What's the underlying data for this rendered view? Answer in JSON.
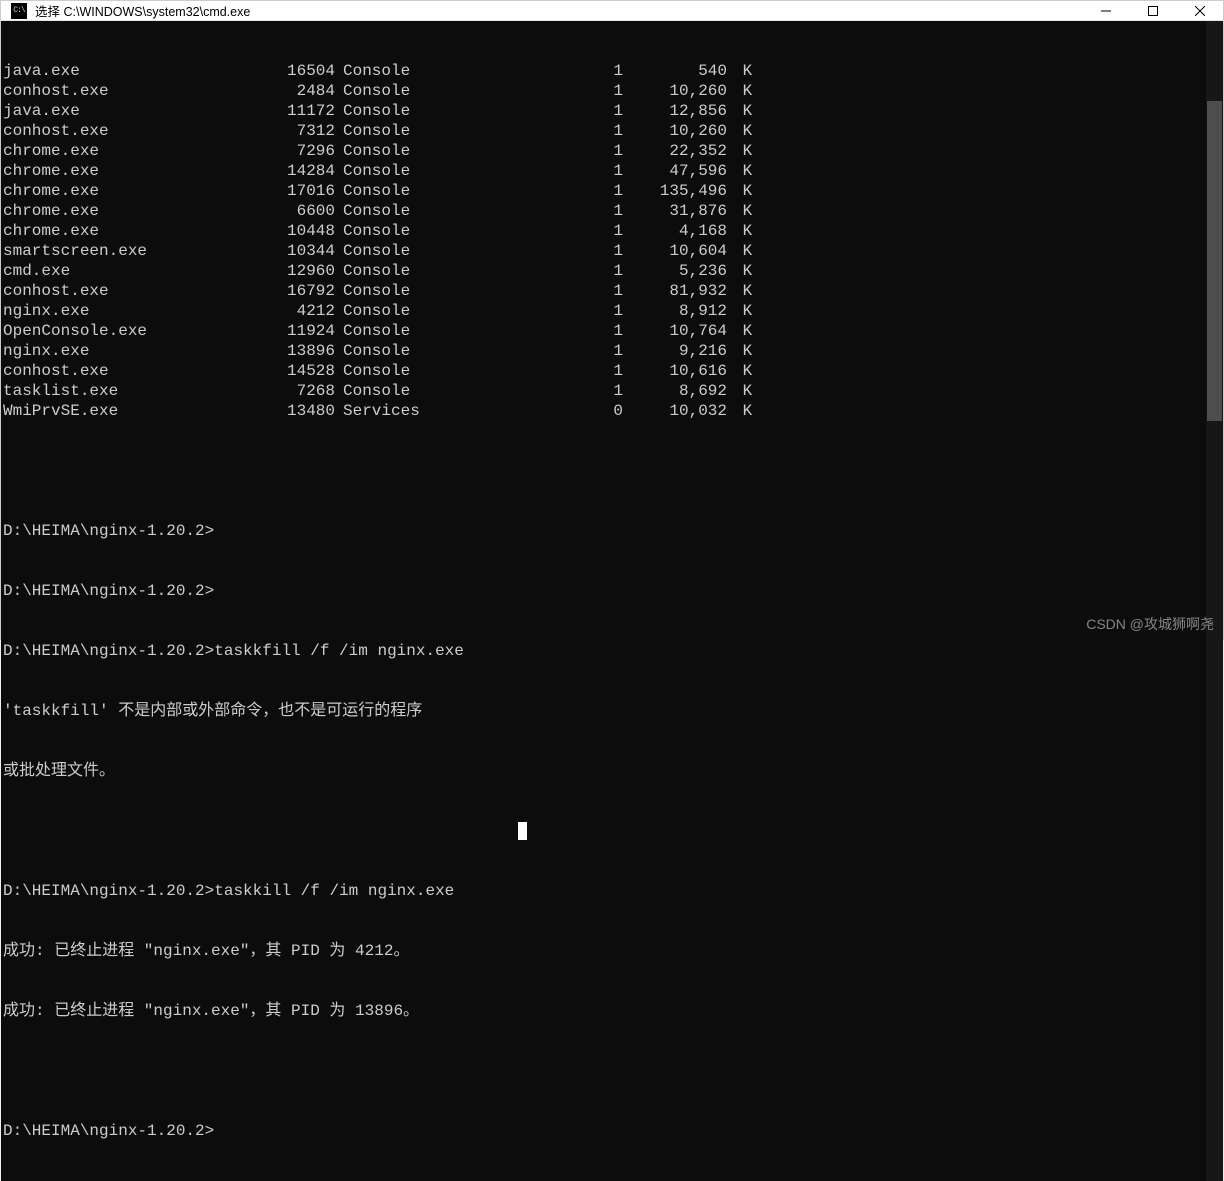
{
  "window": {
    "title": "选择 C:\\WINDOWS\\system32\\cmd.exe",
    "icon_label": "C:\\"
  },
  "processes": [
    {
      "name": "java.exe",
      "pid": "16504",
      "session": "Console",
      "snum": "1",
      "mem": "540",
      "unit": "K"
    },
    {
      "name": "conhost.exe",
      "pid": "2484",
      "session": "Console",
      "snum": "1",
      "mem": "10,260",
      "unit": "K"
    },
    {
      "name": "java.exe",
      "pid": "11172",
      "session": "Console",
      "snum": "1",
      "mem": "12,856",
      "unit": "K"
    },
    {
      "name": "conhost.exe",
      "pid": "7312",
      "session": "Console",
      "snum": "1",
      "mem": "10,260",
      "unit": "K"
    },
    {
      "name": "chrome.exe",
      "pid": "7296",
      "session": "Console",
      "snum": "1",
      "mem": "22,352",
      "unit": "K"
    },
    {
      "name": "chrome.exe",
      "pid": "14284",
      "session": "Console",
      "snum": "1",
      "mem": "47,596",
      "unit": "K"
    },
    {
      "name": "chrome.exe",
      "pid": "17016",
      "session": "Console",
      "snum": "1",
      "mem": "135,496",
      "unit": "K"
    },
    {
      "name": "chrome.exe",
      "pid": "6600",
      "session": "Console",
      "snum": "1",
      "mem": "31,876",
      "unit": "K"
    },
    {
      "name": "chrome.exe",
      "pid": "10448",
      "session": "Console",
      "snum": "1",
      "mem": "4,168",
      "unit": "K"
    },
    {
      "name": "smartscreen.exe",
      "pid": "10344",
      "session": "Console",
      "snum": "1",
      "mem": "10,604",
      "unit": "K"
    },
    {
      "name": "cmd.exe",
      "pid": "12960",
      "session": "Console",
      "snum": "1",
      "mem": "5,236",
      "unit": "K"
    },
    {
      "name": "conhost.exe",
      "pid": "16792",
      "session": "Console",
      "snum": "1",
      "mem": "81,932",
      "unit": "K"
    },
    {
      "name": "nginx.exe",
      "pid": "4212",
      "session": "Console",
      "snum": "1",
      "mem": "8,912",
      "unit": "K"
    },
    {
      "name": "OpenConsole.exe",
      "pid": "11924",
      "session": "Console",
      "snum": "1",
      "mem": "10,764",
      "unit": "K"
    },
    {
      "name": "nginx.exe",
      "pid": "13896",
      "session": "Console",
      "snum": "1",
      "mem": "9,216",
      "unit": "K"
    },
    {
      "name": "conhost.exe",
      "pid": "14528",
      "session": "Console",
      "snum": "1",
      "mem": "10,616",
      "unit": "K"
    },
    {
      "name": "tasklist.exe",
      "pid": "7268",
      "session": "Console",
      "snum": "1",
      "mem": "8,692",
      "unit": "K"
    },
    {
      "name": "WmiPrvSE.exe",
      "pid": "13480",
      "session": "Services",
      "snum": "0",
      "mem": "10,032",
      "unit": "K"
    }
  ],
  "lines": {
    "blank": "",
    "prompt1": "D:\\HEIMA\\nginx-1.20.2>",
    "prompt2": "D:\\HEIMA\\nginx-1.20.2>",
    "prompt3_cmd": "D:\\HEIMA\\nginx-1.20.2>taskkfill /f /im nginx.exe",
    "err1": "'taskkfill' 不是内部或外部命令，也不是可运行的程序",
    "err2": "或批处理文件。",
    "prompt4_cmd": "D:\\HEIMA\\nginx-1.20.2>taskkill /f /im nginx.exe",
    "success1": "成功: 已终止进程 \"nginx.exe\"，其 PID 为 4212。",
    "success2": "成功: 已终止进程 \"nginx.exe\"，其 PID 为 13896。",
    "prompt5": "D:\\HEIMA\\nginx-1.20.2>"
  },
  "watermark": "CSDN @攻城狮啊尧"
}
